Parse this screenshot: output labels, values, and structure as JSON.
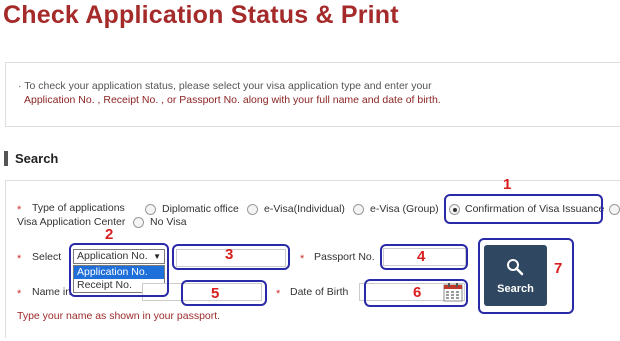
{
  "page": {
    "title": "Check Application Status & Print"
  },
  "info": {
    "line1": "· To check your application status, please select your visa application type and enter your",
    "line2": "Application No. , Receipt No. , or Passport No. along with your full name and date of birth."
  },
  "section": {
    "title": "Search"
  },
  "form": {
    "required_mark": "*",
    "type_label": "Type of applications",
    "options": [
      {
        "label": "Diplomatic office",
        "checked": false
      },
      {
        "label": "e-Visa(Individual)",
        "checked": false
      },
      {
        "label": "e-Visa (Group)",
        "checked": false
      },
      {
        "label": "Confirmation of Visa Issuance",
        "checked": true
      },
      {
        "label": "Visa Application Center",
        "checked": false
      },
      {
        "label": "No Visa",
        "checked": false
      }
    ],
    "select_label": "Select",
    "select_value": "Application No.",
    "select_arrow": "▼",
    "dropdown_options": [
      {
        "label": "Application No.",
        "selected": true
      },
      {
        "label": "Receipt No.",
        "selected": false
      }
    ],
    "passport_label": "Passport No.",
    "name_label": "Name in",
    "dob_label": "Date of Birth",
    "search_button": "Search",
    "hint": "Type your name as shown in your passport."
  },
  "annotations": [
    "1",
    "2",
    "3",
    "4",
    "5",
    "6",
    "7"
  ],
  "colors": {
    "title": "#a52a2a",
    "button": "#2f4760",
    "annotation_box": "#2a2aa8",
    "annotation_number": "#d81e1e",
    "highlight": "#1e6fd9"
  }
}
